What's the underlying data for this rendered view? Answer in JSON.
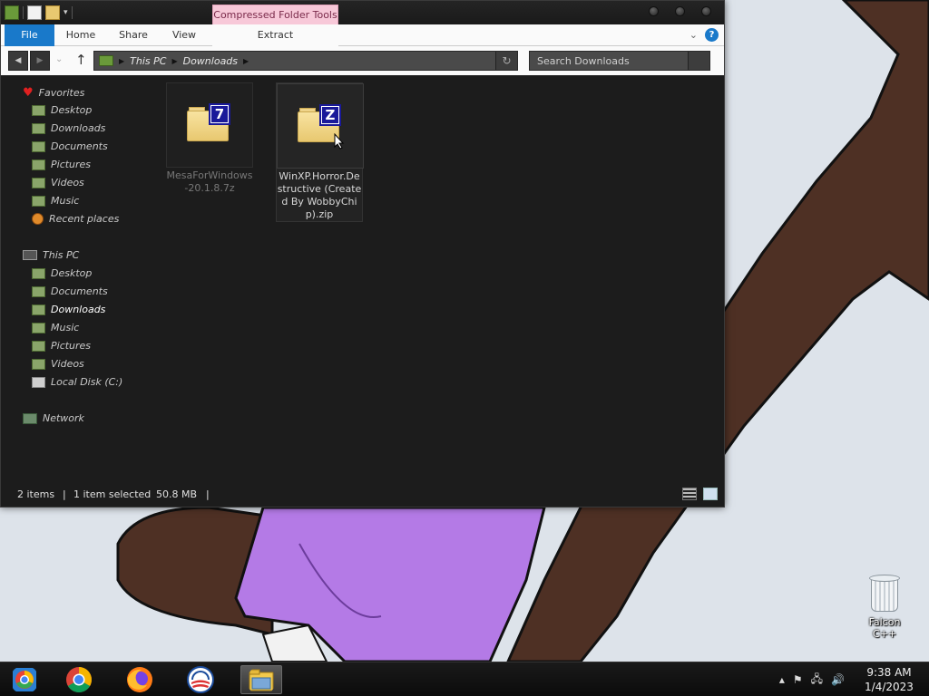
{
  "window": {
    "contextual_tab": "Compressed Folder Tools",
    "ribbon_tabs": {
      "file": "File",
      "home": "Home",
      "share": "Share",
      "view": "View",
      "extract": "Extract"
    },
    "help": "?"
  },
  "address_bar": {
    "crumbs": [
      "This PC",
      "Downloads"
    ]
  },
  "search": {
    "placeholder": "Search Downloads"
  },
  "sidebar": {
    "favorites": {
      "label": "Favorites",
      "items": [
        "Desktop",
        "Downloads",
        "Documents",
        "Pictures",
        "Videos",
        "Music",
        "Recent places"
      ]
    },
    "this_pc": {
      "label": "This PC",
      "items": [
        "Desktop",
        "Documents",
        "Downloads",
        "Music",
        "Pictures",
        "Videos",
        "Local Disk (C:)"
      ],
      "selected": "Downloads"
    },
    "network": {
      "label": "Network"
    }
  },
  "files": [
    {
      "name": "MesaForWindows-20.1.8.7z",
      "badge": "7",
      "selected": false
    },
    {
      "name": "WinXP.Horror.Destructive (Created By WobbyChip).zip",
      "badge": "Z",
      "selected": true
    }
  ],
  "status": {
    "count": "2 items",
    "selection": "1 item selected",
    "size": "50.8 MB"
  },
  "desktop": {
    "recycle_bin_label": "Falcon C++"
  },
  "taskbar": {
    "apps": [
      "chromium-icon",
      "chrome-icon",
      "firefox-icon",
      "obama-icon",
      "file-explorer-icon"
    ],
    "time": "9:38 AM",
    "date": "1/4/2023"
  },
  "colors": {
    "accent": "#1979ca",
    "context_tab": "#f7c8d8",
    "window_bg": "#1c1c1c"
  }
}
